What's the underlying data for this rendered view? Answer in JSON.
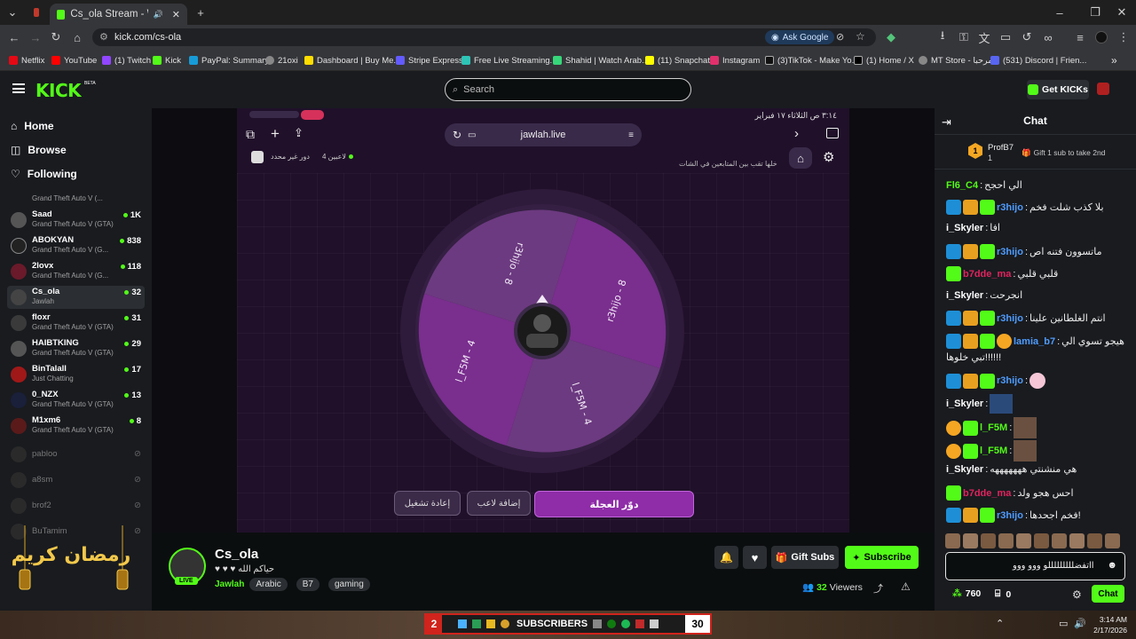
{
  "browser": {
    "tabs": [
      {
        "label": "Cs_ola Stream - Watch Live"
      }
    ],
    "url": "kick.com/cs-ola",
    "ask_google": "Ask Google",
    "bookmarks": [
      "Netflix",
      "YouTube",
      "(1) Twitch",
      "Kick",
      "PayPal: Summary",
      "21oxi",
      "Dashboard | Buy Me...",
      "Stripe Express",
      "Free Live Streaming...",
      "Shahid | Watch Arab...",
      "(11) Snapchat",
      "Instagram",
      "(3)TikTok - Make Yo...",
      "(1) Home / X",
      "MT Store - مرحبا",
      "(531) Discord | Frien..."
    ]
  },
  "header": {
    "logo": "KICK",
    "beta": "BETA",
    "search_placeholder": "Search",
    "get_kicks": "Get KICKs"
  },
  "sidebar": {
    "nav": [
      "Home",
      "Browse",
      "Following"
    ],
    "partial_game": "Grand Theft Auto V (...",
    "channels": [
      {
        "name": "Saad",
        "game": "Grand Theft Auto V (GTA)",
        "viewers": "1K"
      },
      {
        "name": "ABOKYAN",
        "game": "Grand Theft Auto V (G...",
        "viewers": "838"
      },
      {
        "name": "2lovx",
        "game": "Grand Theft Auto V (G...",
        "viewers": "118"
      },
      {
        "name": "Cs_ola",
        "game": "Jawlah",
        "viewers": "32"
      },
      {
        "name": "floxr",
        "game": "Grand Theft Auto V (GTA)",
        "viewers": "31"
      },
      {
        "name": "HAIBTKING",
        "game": "Grand Theft Auto V (GTA)",
        "viewers": "29"
      },
      {
        "name": "BinTalall",
        "game": "Just Chatting",
        "viewers": "17"
      },
      {
        "name": "0_NZX",
        "game": "Grand Theft Auto V (GTA)",
        "viewers": "13"
      },
      {
        "name": "M1xm6",
        "game": "Grand Theft Auto V (GTA)",
        "viewers": "8"
      }
    ],
    "offline": [
      "pabloo",
      "a8sm",
      "brof2",
      "BuTamim"
    ]
  },
  "stream": {
    "phone_time": "٣:١٤ ص  الثلاثاء ١٧ فبراير",
    "phone_url": "jawlah.live",
    "subtitle": "خلها تقب بين المتابعين في الشات",
    "players": "4 لاعبين",
    "round": "دور غير محدد",
    "wheel": [
      "r3hijo - 8",
      "r3hijo - 8",
      "l_F5M - 4",
      "l_F5M - 4"
    ],
    "spin": "دوّر العجلة",
    "add_player": "إضافة لاعب",
    "restart": "إعادة تشغيل"
  },
  "channel": {
    "name": "Cs_ola",
    "live": "LIVE",
    "bio": "♥ ♥ ♥ حياكم الله",
    "category": "Jawlah",
    "tags": [
      "Arabic",
      "B7",
      "gaming"
    ],
    "gift": "Gift Subs",
    "subscribe": "Subscribe",
    "viewers": "32",
    "viewers_label": "Viewers"
  },
  "chat": {
    "title": "Chat",
    "top_gifter": "ProfB7",
    "top_count": "1",
    "gift_prompt": "Gift 1 sub to take 2nd",
    "messages": [
      {
        "user": "Fl6_C4",
        "text": "الي احجح",
        "color": "#53fc18"
      },
      {
        "user": "r3hijo",
        "text": "بلا كذب شلت فخم",
        "color": "#4f9cff"
      },
      {
        "user": "i_Skyler",
        "text": "افا",
        "color": "#ffffff"
      },
      {
        "user": "r3hijo",
        "text": "ماتسوون فتنه اص",
        "color": "#4f9cff"
      },
      {
        "user": "b7dde_ma",
        "text": "قلبي قلبي",
        "color": "#e0245e"
      },
      {
        "user": "i_Skyler",
        "text": "انجرحت",
        "color": "#ffffff"
      },
      {
        "user": "r3hijo",
        "text": "انتم الغلطانين علينا",
        "color": "#4f9cff"
      },
      {
        "user": "lamia_b7",
        "text": "هيجو تسوي الي",
        "color": "#4f9cff"
      },
      {
        "user": "",
        "text": "تبي خلوها!!!!!!",
        "color": "#ffffff"
      },
      {
        "user": "r3hijo",
        "text": "",
        "color": "#4f9cff"
      },
      {
        "user": "i_Skyler",
        "text": "",
        "color": "#ffffff"
      },
      {
        "user": "l_F5M",
        "text": "",
        "color": "#53fc18"
      },
      {
        "user": "l_F5M",
        "text": "",
        "color": "#53fc18"
      },
      {
        "user": "i_Skyler",
        "text": "هي منشنتي هههههههه",
        "color": "#ffffff"
      },
      {
        "user": "b7dde_ma",
        "text": "احس هجو ولد",
        "color": "#e0245e"
      },
      {
        "user": "r3hijo",
        "text": "فخم اجحدها!",
        "color": "#4f9cff"
      }
    ],
    "input": "ااتفضلللللللللو ووو ووو",
    "points": "760",
    "redeem": "0",
    "send": "Chat"
  },
  "taskbar": {
    "badge": "2",
    "subscribers": "SUBSCRIBERS",
    "sub_count": "30",
    "time": "3:14 AM",
    "date": "2/17/2026"
  },
  "overlay": {
    "ramadan": "رمضان كريم"
  }
}
